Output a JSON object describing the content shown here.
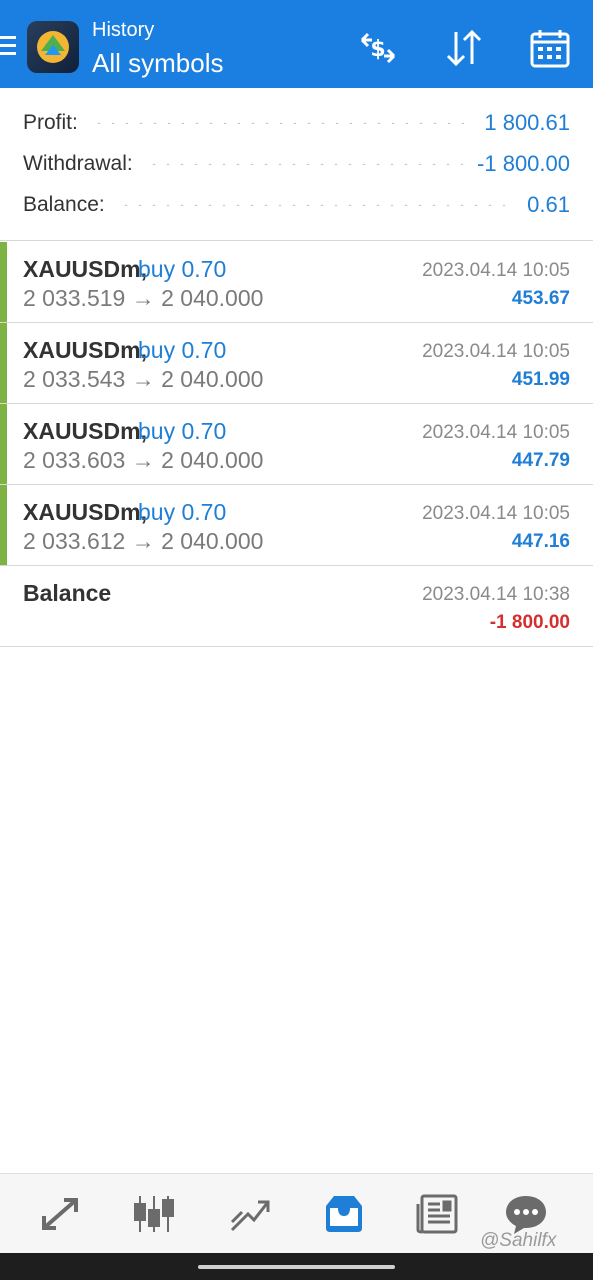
{
  "header": {
    "subtitle": "History",
    "title": "All symbols"
  },
  "summary": {
    "profit_label": "Profit:",
    "profit_value": "1 800.61",
    "withdrawal_label": "Withdrawal:",
    "withdrawal_value": "-1 800.00",
    "balance_label": "Balance:",
    "balance_value": "0.61"
  },
  "deals": [
    {
      "symbol": "XAUUSDm,",
      "direction": "buy 0.70",
      "prices": "2 033.519 → 2 040.000",
      "time": "2023.04.14 10:05",
      "profit": "453.67"
    },
    {
      "symbol": "XAUUSDm,",
      "direction": "buy 0.70",
      "prices": "2 033.543 → 2 040.000",
      "time": "2023.04.14 10:05",
      "profit": "451.99"
    },
    {
      "symbol": "XAUUSDm,",
      "direction": "buy 0.70",
      "prices": "2 033.603 → 2 040.000",
      "time": "2023.04.14 10:05",
      "profit": "447.79"
    },
    {
      "symbol": "XAUUSDm,",
      "direction": "buy 0.70",
      "prices": "2 033.612 → 2 040.000",
      "time": "2023.04.14 10:05",
      "profit": "447.16"
    }
  ],
  "balance_op": {
    "label": "Balance",
    "time": "2023.04.14 10:38",
    "amount": "-1 800.00"
  },
  "nav": [
    "trade-icon",
    "quotes-icon",
    "chart-icon",
    "history-icon",
    "news-icon",
    "chat-icon"
  ],
  "watermark": "@Sahilfx",
  "colors": {
    "accent": "#1a7fe0",
    "positive": "#1f7ed6",
    "negative": "#d32f2f",
    "buy_bar": "#7cb342"
  }
}
